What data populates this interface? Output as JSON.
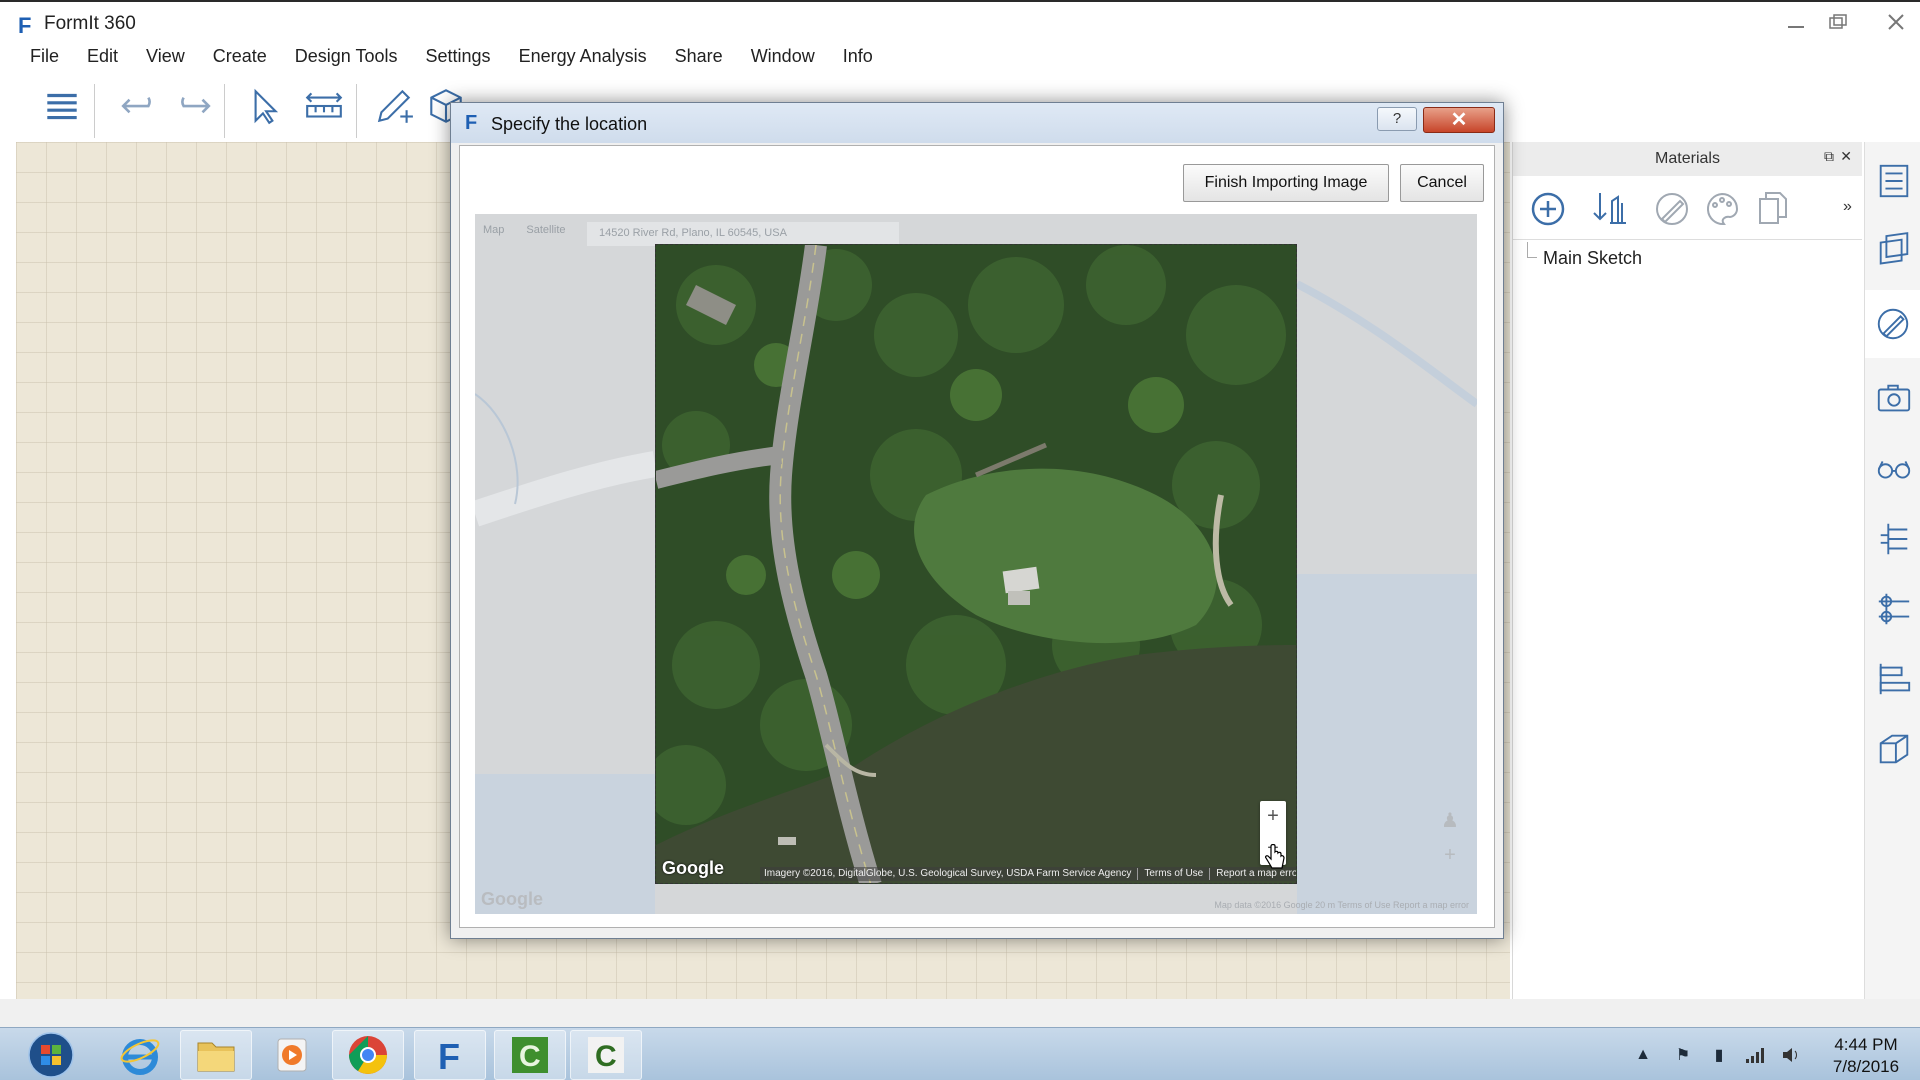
{
  "app": {
    "title": "FormIt 360",
    "logo_letter": "F"
  },
  "menu": [
    "File",
    "Edit",
    "View",
    "Create",
    "Design Tools",
    "Settings",
    "Energy Analysis",
    "Share",
    "Window",
    "Info"
  ],
  "toolbar_icons": [
    "list-icon",
    "undo-icon",
    "redo-icon",
    "select-arrow-icon",
    "dimension-icon",
    "sketch-pencil-icon",
    "cube-icon"
  ],
  "dialog": {
    "logo_letter": "F",
    "title": "Specify the location",
    "help_label": "?",
    "close_label": "✕",
    "finish_button": "Finish Importing Image",
    "cancel_button": "Cancel"
  },
  "map": {
    "tab_map": "Map",
    "tab_satellite": "Satellite",
    "address": "14520 River Rd, Plano, IL 60545, USA",
    "google_logo": "Google",
    "faded_google_logo": "Google",
    "faded_footer": "Map data ©2016 Google   20 m   Terms of Use   Report a map error",
    "attribution": "Imagery ©2016, DigitalGlobe, U.S. Geological Survey, USDA Farm Service Agency",
    "terms": "Terms of Use",
    "report": "Report a map error",
    "zoom_in": "+",
    "zoom_out": "−"
  },
  "materials_panel": {
    "title": "Materials",
    "tree_item": "Main Sketch",
    "overflow": "»"
  },
  "clock": {
    "time": "4:44 PM",
    "date": "7/8/2016"
  }
}
